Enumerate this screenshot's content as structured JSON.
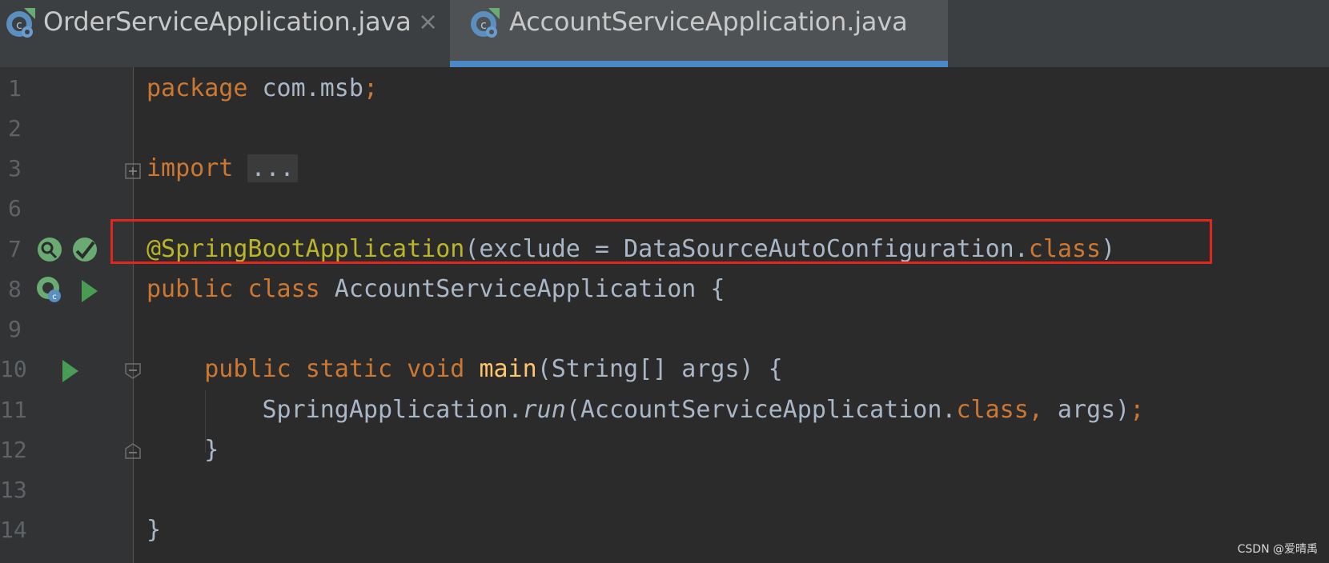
{
  "tabs": [
    {
      "label": "OrderServiceApplication.java",
      "close": "×",
      "active": false,
      "icon": "spring-boot-class-icon"
    },
    {
      "label": "AccountServiceApplication.java",
      "close": "×",
      "active": true,
      "icon": "spring-boot-class-icon"
    }
  ],
  "editor": {
    "line_numbers": [
      "1",
      "2",
      "3",
      "6",
      "7",
      "8",
      "9",
      "10",
      "11",
      "12",
      "13",
      "14"
    ],
    "lines": {
      "l1": {
        "kw": "package",
        "rest": " com.msb",
        "semi": ";"
      },
      "l3": {
        "kw": "import",
        "dots": "..."
      },
      "l7": {
        "ann": "@SpringBootApplication",
        "open": "(exclude = DataSourceAutoConfiguration.",
        "kw": "class",
        "close": ")"
      },
      "l8": {
        "kw1": "public",
        "kw2": "class",
        "rest": " AccountServiceApplication {"
      },
      "l10": {
        "indent": "    ",
        "kw1": "public",
        "kw2": "static",
        "kw3": "void",
        "fn": "main",
        "rest": "(String[] args) {"
      },
      "l11": {
        "indent": "        ",
        "a": "SpringApplication.",
        "run": "run",
        "b": "(AccountServiceApplication.",
        "kw": "class",
        "comma": ",",
        "c": " args)",
        "semi": ";"
      },
      "l12": {
        "text": "    }"
      },
      "l14": {
        "text": "}"
      }
    }
  },
  "watermark": "CSDN @爱晴禹",
  "colors": {
    "background": "#2b2b2b",
    "keyword": "#cc7832",
    "annotation": "#bbb529",
    "method": "#ffc66d",
    "text": "#a9b7c6",
    "highlight_border": "#e0261d",
    "active_tab_underline": "#4a88c7"
  }
}
